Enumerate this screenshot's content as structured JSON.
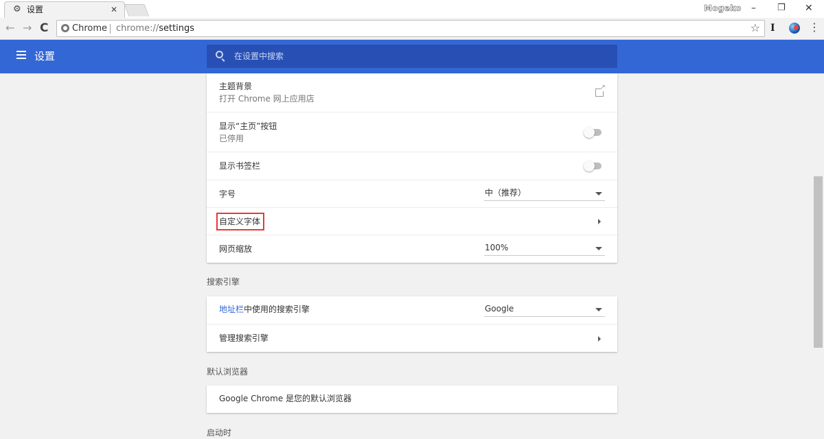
{
  "browser": {
    "tab": {
      "title": "设置",
      "close": "✕"
    },
    "profile_name": "Mogeko",
    "window_controls": {
      "minimize": "–",
      "restore": "❐",
      "close": "✕"
    },
    "nav": {
      "back": "←",
      "forward": "→",
      "reload": "C"
    },
    "omnibox": {
      "chip": "Chrome",
      "scheme": "chrome://",
      "host": "settings",
      "star": "☆"
    },
    "extension_1": "I",
    "menu": "⋮"
  },
  "header": {
    "title": "设置",
    "search_placeholder": "在设置中搜索"
  },
  "appearance": {
    "theme": {
      "label": "主题背景",
      "sub": "打开 Chrome 网上应用店"
    },
    "home_button": {
      "label": "显示“主页”按钮",
      "sub": "已停用",
      "enabled": false
    },
    "bookmarks_bar": {
      "label": "显示书签栏",
      "enabled": false
    },
    "font_size": {
      "label": "字号",
      "value": "中（推荐）"
    },
    "custom_fonts": {
      "label": "自定义字体"
    },
    "page_zoom": {
      "label": "网页缩放",
      "value": "100%"
    }
  },
  "search_engine": {
    "section_title": "搜索引擎",
    "address_bar": {
      "label_link": "地址栏",
      "label_rest": "中使用的搜索引擎",
      "value": "Google"
    },
    "manage": {
      "label": "管理搜索引擎"
    }
  },
  "default_browser": {
    "section_title": "默认浏览器",
    "status": "Google Chrome 是您的默认浏览器"
  },
  "startup": {
    "section_title": "启动时"
  },
  "colors": {
    "accent": "#3367d6",
    "highlight": "#e53935"
  }
}
